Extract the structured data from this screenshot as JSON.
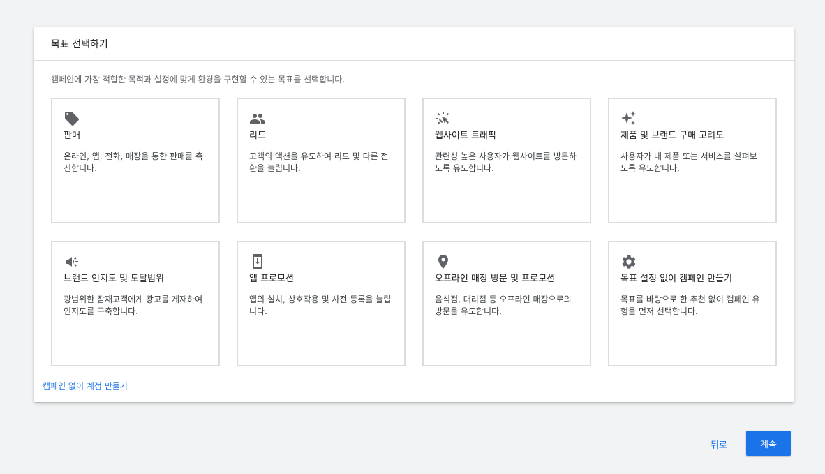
{
  "dialog": {
    "title": "목표 선택하기",
    "description": "캠페인에 가장 적합한 목적과 설정에 맞게 환경을 구현할 수 있는 목표를 선택합니다."
  },
  "goals": [
    {
      "icon": "tag-icon",
      "title": "판매",
      "desc": "온라인, 앱, 전화, 매장을 통한 판매를 촉진합니다."
    },
    {
      "icon": "people-icon",
      "title": "리드",
      "desc": "고객의 액션을 유도하여 리드 및 다른 전환을 늘립니다."
    },
    {
      "icon": "click-cursor-icon",
      "title": "웹사이트 트래픽",
      "desc": "관련성 높은 사용자가 웹사이트를 방문하도록 유도합니다."
    },
    {
      "icon": "sparkle-icon",
      "title": "제품 및 브랜드 구매 고려도",
      "desc": "사용자가 내 제품 또는 서비스를 살펴보도록 유도합니다."
    },
    {
      "icon": "megaphone-icon",
      "title": "브랜드 인지도 및 도달범위",
      "desc": "광범위한 잠재고객에게 광고를 게재하여 인지도를 구축합니다."
    },
    {
      "icon": "phone-download-icon",
      "title": "앱 프로모션",
      "desc": "앱의 설치, 상호작용 및 사전 등록을 늘립니다."
    },
    {
      "icon": "location-pin-icon",
      "title": "오프라인 매장 방문 및 프로모션",
      "desc": "음식점, 대리점 등 오프라인 매장으로의 방문을 유도합니다."
    },
    {
      "icon": "gear-icon",
      "title": "목표 설정 없이 캠페인 만들기",
      "desc": "목표를 바탕으로 한 추천 없이 캠페인 유형을 먼저 선택합니다."
    }
  ],
  "footer": {
    "link": "캠페인 없이 계정 만들기"
  },
  "actions": {
    "back": "뒤로",
    "continue": "계속"
  },
  "colors": {
    "accent": "#1a73e8",
    "border": "#dadce0",
    "icon": "#5f6368"
  }
}
